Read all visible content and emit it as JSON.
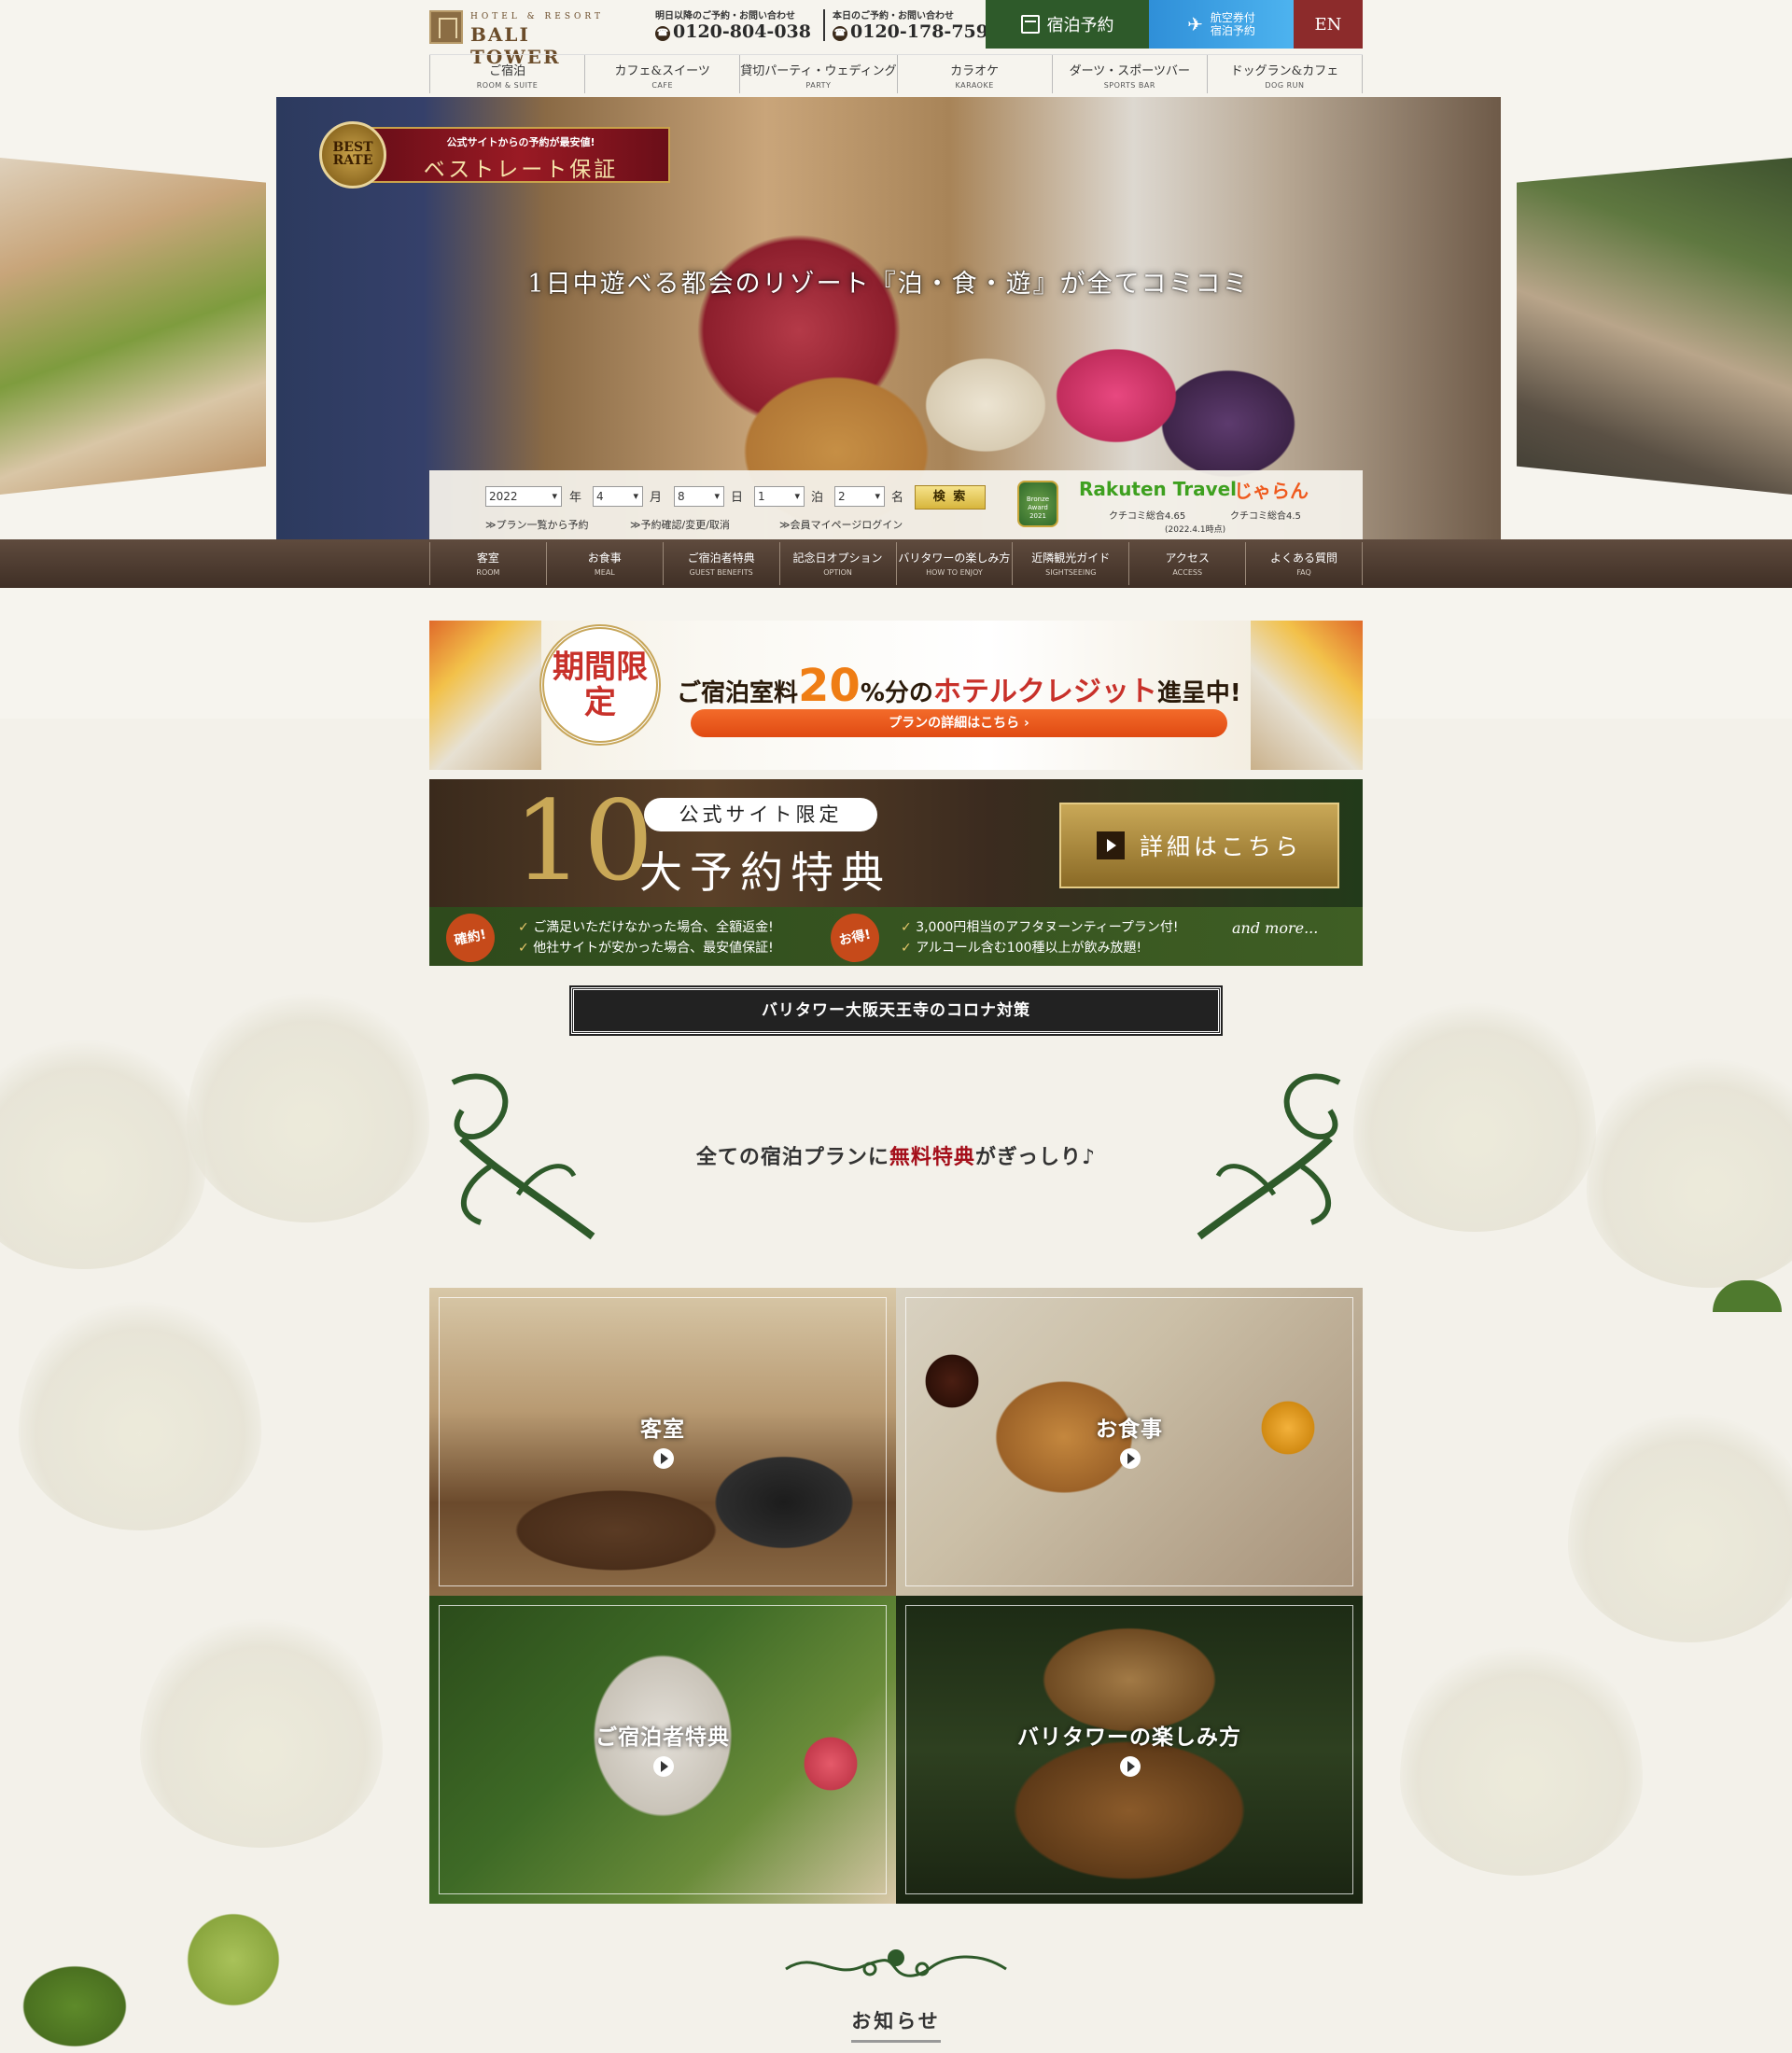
{
  "header": {
    "logo_sub": "HOTEL & RESORT",
    "logo_main": "BALI TOWER",
    "contact_tomorrow": {
      "caption": "明日以降のご予約・お問い合わせ",
      "number": "0120-804-038"
    },
    "contact_today": {
      "caption": "本日のご予約・お問い合わせ",
      "number": "0120-178-759"
    },
    "reserve_label": "宿泊予約",
    "air_line1": "航空券付",
    "air_line2": "宿泊予約",
    "lang_label": "EN"
  },
  "gnav": [
    {
      "jp": "ご宿泊",
      "en": "ROOM & SUITE"
    },
    {
      "jp": "カフェ&スイーツ",
      "en": "CAFE"
    },
    {
      "jp": "貸切パーティ・ウェディング",
      "en": "PARTY"
    },
    {
      "jp": "カラオケ",
      "en": "KARAOKE"
    },
    {
      "jp": "ダーツ・スポーツバー",
      "en": "SPORTS BAR"
    },
    {
      "jp": "ドッグラン&カフェ",
      "en": "DOG RUN"
    }
  ],
  "hero": {
    "catchcopy": "1日中遊べる都会のリゾート『泊・食・遊』が全てコミコミ",
    "bestrate_badge": "BEST RATE",
    "bestrate_small": "公式サイトからの予約が最安値!",
    "bestrate_big": "ベストレート保証"
  },
  "search": {
    "year": "2022",
    "year_unit": "年",
    "month": "4",
    "month_unit": "月",
    "day": "8",
    "day_unit": "日",
    "nights": "1",
    "nights_unit": "泊",
    "guests": "2",
    "guests_unit": "名",
    "search_label": "検 索",
    "link_plans": "≫プラン一覧から予約",
    "link_confirm": "≫予約確認/変更/取消",
    "link_mypage": "≫会員マイページログイン",
    "award_text": "Bronze Award 2021",
    "rakuten_label": "Rakuten Travel",
    "rakuten_review": "クチコミ総合4.65",
    "jalan_label": "じゃらん",
    "jalan_review": "クチコミ総合4.5",
    "review_date": "(2022.4.1時点)"
  },
  "subnav": [
    {
      "jp": "客室",
      "en": "ROOM"
    },
    {
      "jp": "お食事",
      "en": "MEAL"
    },
    {
      "jp": "ご宿泊者特典",
      "en": "GUEST BENEFITS"
    },
    {
      "jp": "記念日オプション",
      "en": "OPTION"
    },
    {
      "jp": "バリタワーの楽しみ方",
      "en": "HOW TO ENJOY"
    },
    {
      "jp": "近隣観光ガイド",
      "en": "SIGHTSEEING"
    },
    {
      "jp": "アクセス",
      "en": "ACCESS"
    },
    {
      "jp": "よくある質問",
      "en": "FAQ"
    }
  ],
  "banner_credit": {
    "stamp": "期間限定",
    "headline_pre": "ご宿泊室料",
    "headline_pct": "20",
    "headline_mid": "%分の",
    "headline_accent": "ホテルクレジット",
    "headline_post": "進呈中!",
    "button": "プランの詳細はこちら ›"
  },
  "banner_benefits": {
    "number": "10",
    "pill": "公式サイト限定",
    "title": "大予約特典",
    "detail_button": "詳細はこちら",
    "tag1": "確約!",
    "line1": "ご満足いただけなかった場合、全額返金!",
    "line2": "他社サイトが安かった場合、最安値保証!",
    "tag2": "お得!",
    "line3": "3,000円相当のアフタヌーンティープラン付!",
    "line4": "アルコール含む100種以上が飲み放題!",
    "more": "and more..."
  },
  "corona": {
    "label": "バリタワー大阪天王寺のコロナ対策"
  },
  "intro": {
    "pre": "全ての宿泊プランに",
    "accent": "無料特典",
    "post": "がぎっしり♪"
  },
  "categories": [
    {
      "label": "客室"
    },
    {
      "label": "お食事"
    },
    {
      "label": "ご宿泊者特典"
    },
    {
      "label": "バリタワーの楽しみ方"
    }
  ],
  "news": {
    "title": "お知らせ"
  },
  "colors": {
    "brand_green": "#2e5a2a",
    "accent_red": "#a40f1a",
    "en_button": "#8c2b2b"
  }
}
